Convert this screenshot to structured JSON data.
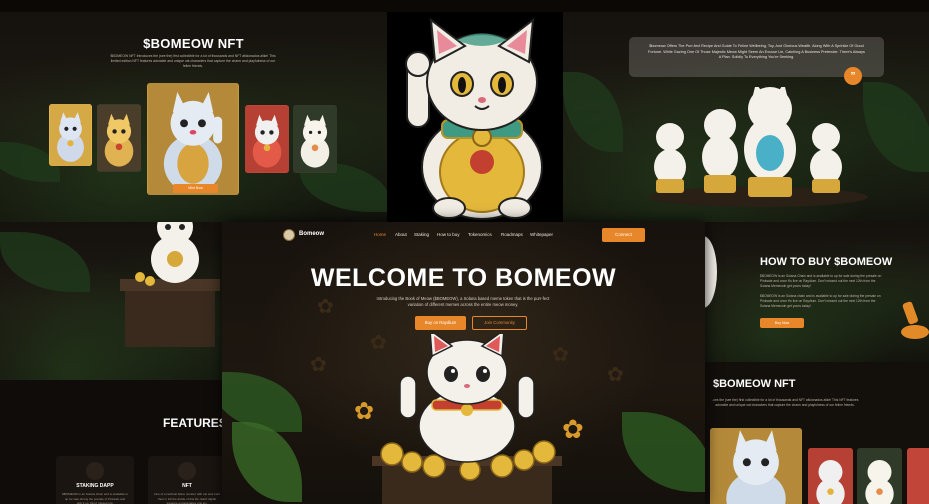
{
  "nft_top_left": {
    "title": "$BOMEOW NFT",
    "description": "$BOMEOW NFT Introduces the (see the) first collectible for a lot of thousands and NFT aficionados alike! This limited edition NFT features adorable and unique cat characters that capture the charm and playfulness of our feline friends.",
    "mint_label": "Mint Now"
  },
  "top_right": {
    "quote": "$bomeow Offers The Purr-fect Recipe And Guide To Feline Wellbeing, Toy, And Glorious Wealth. Along With A Sprinkle Of Good Fortune. While Gazing One Of Those Majestic Meow Might Seem An Excuse Lie, Catching A Business Pretender. There's Always A Plan. Solidly To Everything You're Seeking.",
    "quote_icon": "quote-icon"
  },
  "features": {
    "title": "FEATURES",
    "cards": [
      {
        "label": "STAKING DAPP",
        "text": "$BOMEOW is an Solana chain and is available to up for sale during the presale of Pinksale and pick it up. Don't missed out."
      },
      {
        "label": "NFT",
        "text": "One of a cardinal feline number with cat sets held their in full the divide of this life. Each digital treasure encapsulates one joy."
      }
    ]
  },
  "how_to_buy": {
    "title": "HOW TO BUY $BOMEOW",
    "text1": "$BOMEOW is an Solana Chain and is available to up for sale during the presale on Pinksale and once it's live on Raydium. Don't missed out the next 12th from the Solana Memecoin get yours today!",
    "text2": "$BOMEOW is an Solana chain and is available to up for sale during the presale on Pinksale and once it's live on Raydium. Don't missed out the next 12th from the Solana Memecoin get yours today!",
    "buy_label": "Buy Now"
  },
  "nft_bottom_right": {
    "title": "$BOMEOW NFT",
    "description": "..ces the (see the) first collectible for a lot of thousands and NFT aficionados alike! This NFT features adorable and unique cat characters that capture the charm and playfulness of our feline friends."
  },
  "hero": {
    "logo_text": "Bomeow",
    "nav": [
      "Home",
      "About",
      "Staking",
      "How to buy",
      "Tokenomics",
      "Roadmaps",
      "Whitepaper"
    ],
    "connect_label": "Connect",
    "title": "WELCOME TO BOMEOW",
    "description": "Introducing the Book of Meow ($BOMEOW), a Solana based meme token that is the purr-fect variation of different memes across the entire meow money.",
    "primary_button": "Buy on Raydium",
    "secondary_button": "Join Community"
  },
  "colors": {
    "accent": "#e8862a",
    "background": "#0b0806"
  }
}
